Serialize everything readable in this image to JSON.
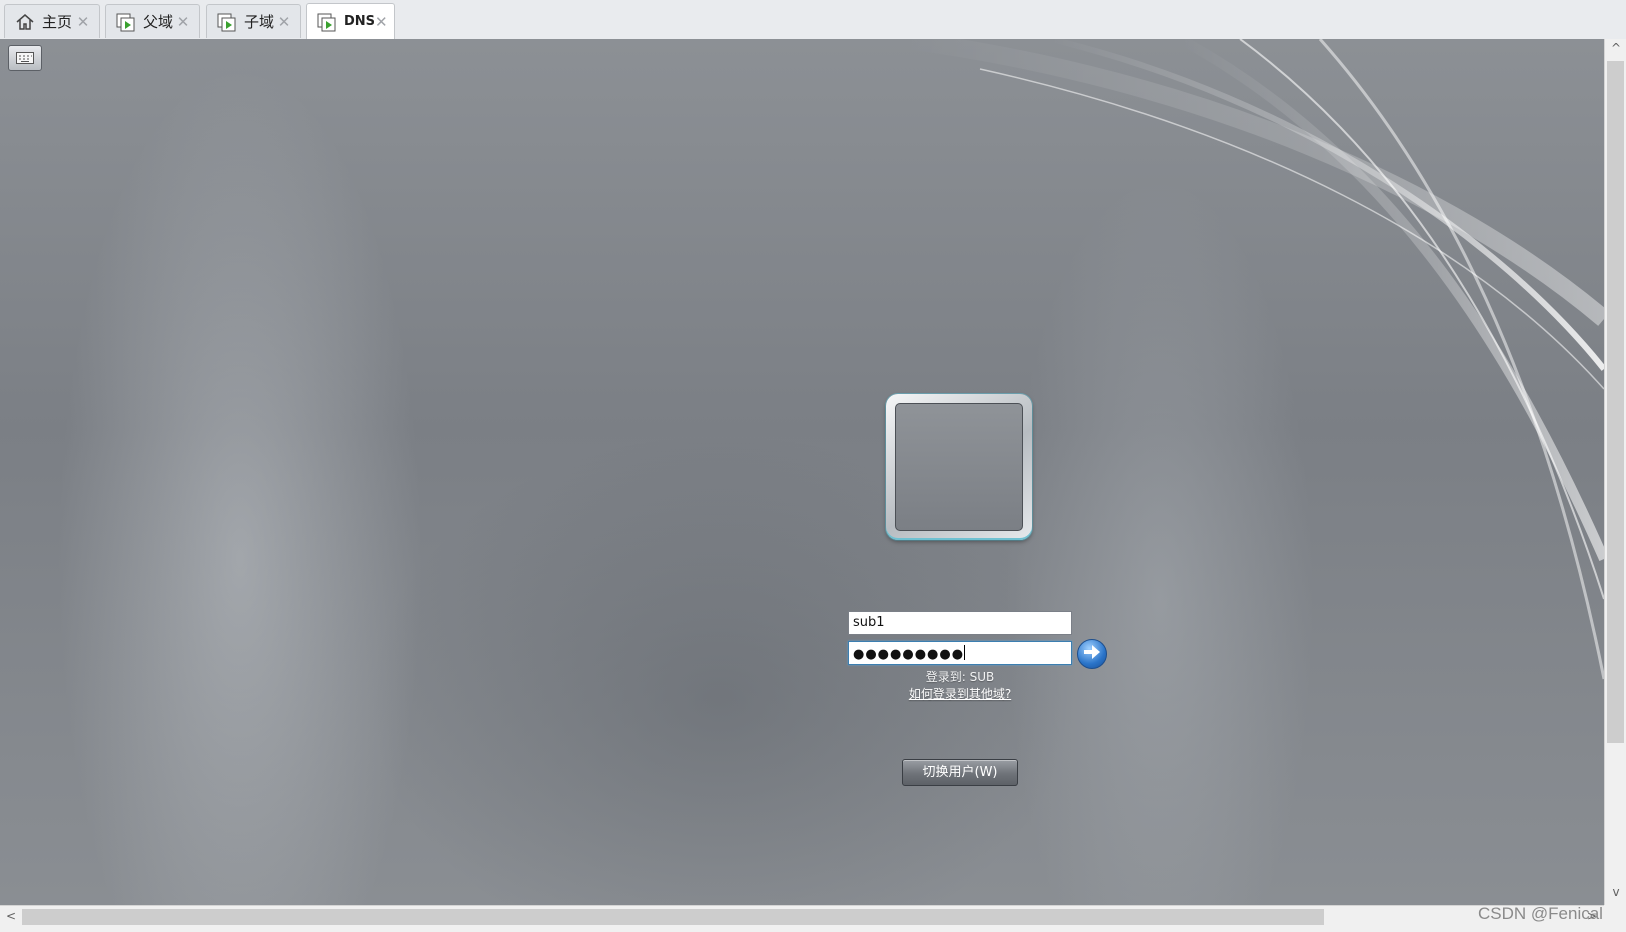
{
  "tabs": [
    {
      "label": "主页",
      "icon": "home-icon",
      "active": false
    },
    {
      "label": "父域",
      "icon": "vm-icon",
      "active": false
    },
    {
      "label": "子域",
      "icon": "vm-icon",
      "active": false
    },
    {
      "label": "DNS",
      "icon": "vm-icon",
      "active": true
    }
  ],
  "toolbar": {
    "keyboard_icon": "keyboard-icon"
  },
  "login": {
    "username": "sub1",
    "password_mask": "●●●●●●●●●",
    "login_to": "登录到: SUB",
    "other_domain_link": "如何登录到其他域?",
    "switch_user_label": "切换用户(W)",
    "go_icon": "arrow-right-icon"
  },
  "scrollbars": {
    "up": "^",
    "down": "v",
    "left": "<",
    "right": ">"
  },
  "watermark": "CSDN @Fenical"
}
